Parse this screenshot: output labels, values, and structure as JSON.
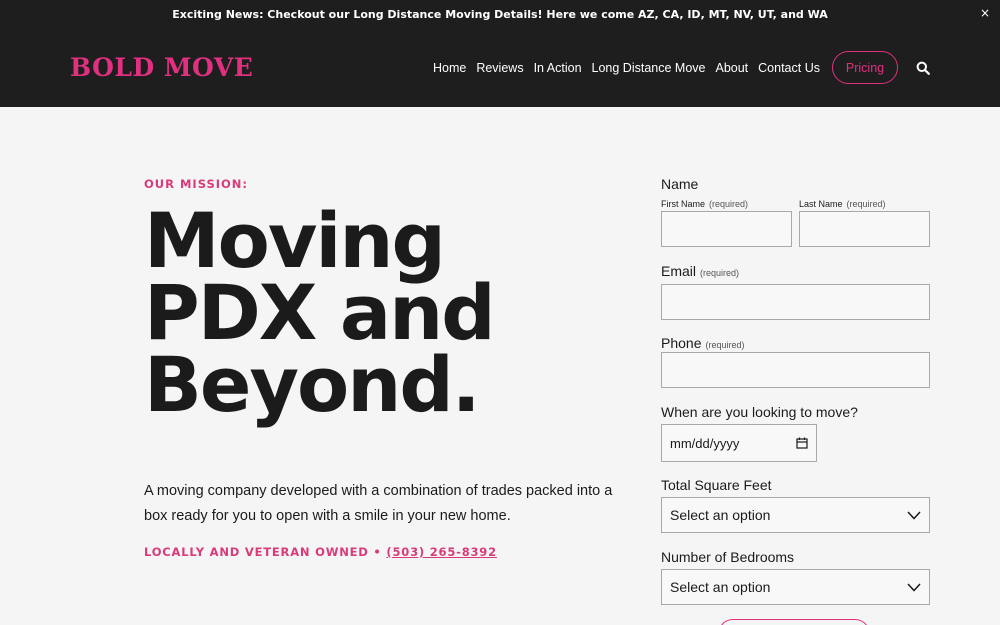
{
  "announcement": {
    "text": "Exciting News: Checkout our Long Distance Moving Details! Here we come AZ, CA, ID, MT, NV, UT, and WA",
    "close_icon": "close-icon"
  },
  "header": {
    "logo": "BOLD MOVE",
    "nav": [
      "Home",
      "Reviews",
      "In Action",
      "Long Distance Move",
      "About",
      "Contact Us"
    ],
    "pricing": "Pricing",
    "search_icon": "search-icon"
  },
  "hero": {
    "mission_label": "OUR MISSION:",
    "headline": [
      "Moving",
      "PDX and",
      "Beyond."
    ],
    "description": "A moving company developed with a combination of trades packed into a box ready for you to open with a smile in your new home.",
    "owned": "LOCALLY AND VETERAN OWNED •",
    "phone": "(503) 265-8392"
  },
  "form": {
    "name_label": "Name",
    "first_name_label": "First Name",
    "last_name_label": "Last Name",
    "required": "(required)",
    "email_label": "Email",
    "phone_label": "Phone",
    "move_date_label": "When are you looking to move?",
    "date_placeholder": "mm/dd/yyyy",
    "sqft_label": "Total Square Feet",
    "sqft_value": "Select an option",
    "bedrooms_label": "Number of Bedrooms",
    "bedrooms_value": "Select an option"
  },
  "colors": {
    "accent": "#e0307f",
    "dark": "#1e1e1e",
    "background": "#f5f5f5"
  }
}
